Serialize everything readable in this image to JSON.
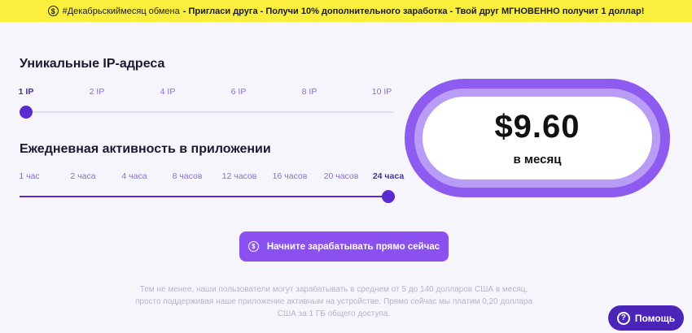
{
  "banner": {
    "icon": "dollar-coin-icon",
    "hashtag": "#Декабрьскиймесяц обмена",
    "promo": "- Пригласи друга - Получи 10% дополнительного заработка - Твой друг МГНОВЕННО получит 1 доллар!"
  },
  "ip_section": {
    "title": "Уникальные IP-адреса",
    "ticks": [
      "1 IP",
      "2 IP",
      "4 IP",
      "6 IP",
      "8 IP",
      "10 IP"
    ],
    "selected": "1 IP",
    "selected_index": 0
  },
  "activity_section": {
    "title": "Ежедневная активность в приложении",
    "ticks": [
      "1 час",
      "2 часа",
      "4 часа",
      "8 часов",
      "12 часов",
      "16 часов",
      "20 часов",
      "24 часа"
    ],
    "selected": "24 часа",
    "selected_index": 7
  },
  "price": {
    "value": "$9.60",
    "period": "в месяц"
  },
  "cta": {
    "icon": "dollar-circle-icon",
    "label": "Начните зарабатывать прямо сейчас"
  },
  "note": "Тем не менее, наши пользователи могут зарабатывать в среднем от 5 до 140 долларов США в месяц, просто поддерживая наше приложение активным на устройстве. Прямо сейчас мы платим 0,20 доллара США за 1 ГБ общего доступа.",
  "help": {
    "icon": "question-circle-icon",
    "label": "Помощь"
  },
  "colors": {
    "accent": "#5a2ccf",
    "cta": "#8a50f0",
    "banner": "#fbef3e",
    "help": "#4a25b8"
  }
}
